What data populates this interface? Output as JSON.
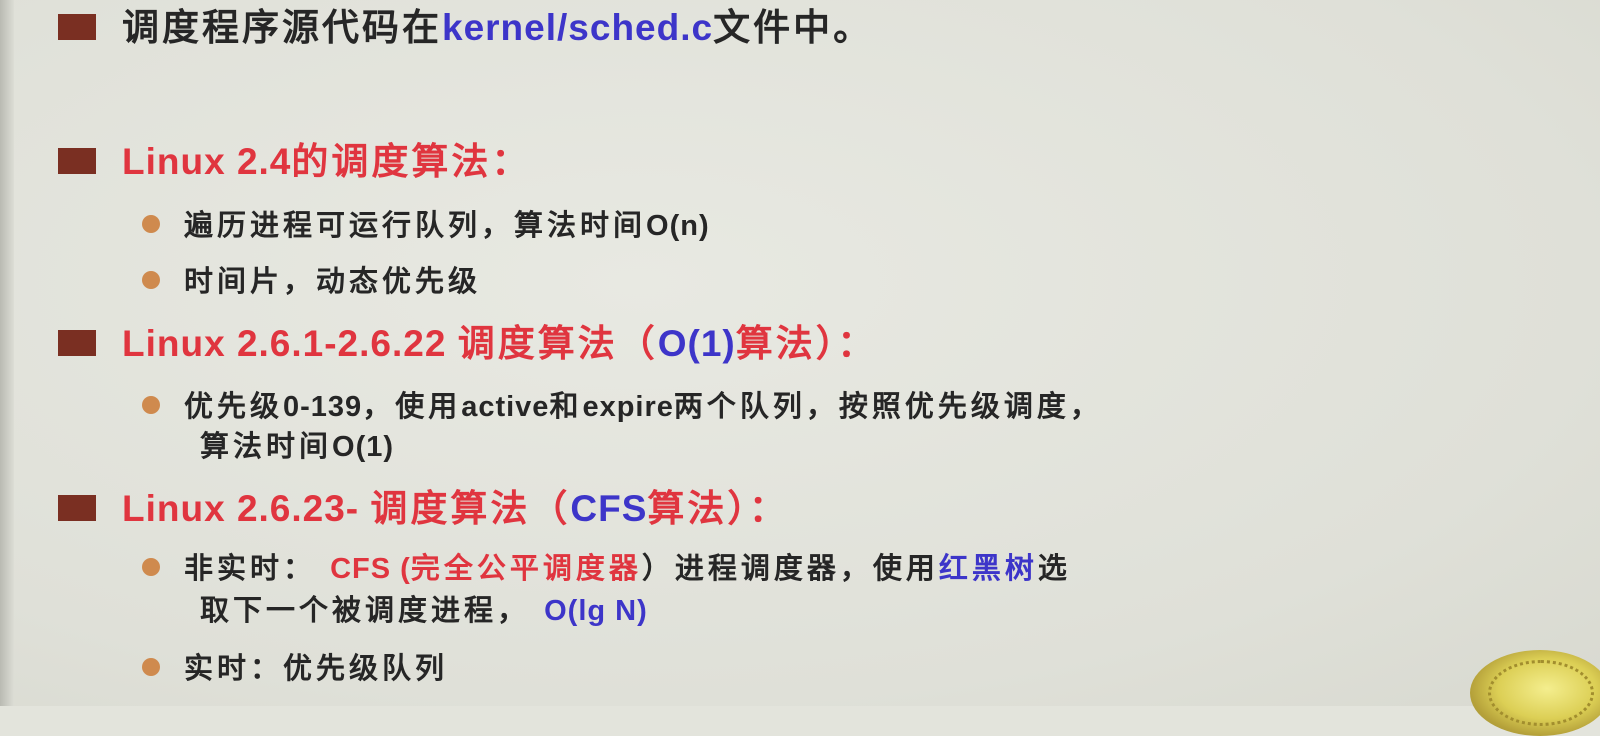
{
  "lines": {
    "l1": {
      "a": "调度程序源代码在",
      "b": "kernel/sched.c",
      "c": "文件中。"
    },
    "l2": {
      "a": "Linux 2.4",
      "b": "的调度算法："
    },
    "l3": {
      "a": "遍历进程可运行队列，算法时间",
      "b": "O(n)"
    },
    "l4": {
      "a": "时间片，动态优先级"
    },
    "l5": {
      "a": "Linux 2.6.1-2.6.22 ",
      "b": "调度算法（",
      "c": "O(1)",
      "d": "算法）："
    },
    "l6": {
      "a": "优先级",
      "b": "0-139",
      "c": "，使用",
      "d": "active",
      "e": "和",
      "f": "expire",
      "g": "两个队列，按照优先级调度，"
    },
    "l6b": {
      "a": "算法时间",
      "b": "O(1)"
    },
    "l7": {
      "a": "Linux 2.6.23- ",
      "b": "调度算法（",
      "c": "CFS",
      "d": "算法）："
    },
    "l8": {
      "a": "非实时： ",
      "b": "CFS",
      "c": " (",
      "d": "完全公平调度器",
      "e": "）进程调度器，使用",
      "f": "红黑树",
      "g": "选"
    },
    "l8b": {
      "a": "取下一个被调度进程， ",
      "b": "O(lg N)"
    },
    "l9": {
      "a": "实时：优先级队列"
    }
  },
  "colors": {
    "black": "#262626",
    "red": "#e0353f",
    "blue": "#3d35c9",
    "square_bullet": "#7a2f22",
    "round_bullet": "#cf8a4e"
  },
  "icons": {
    "level1_bullet": "square-bullet-icon",
    "level2_bullet": "round-bullet-icon",
    "corner_decoration": "decoration-icon"
  }
}
